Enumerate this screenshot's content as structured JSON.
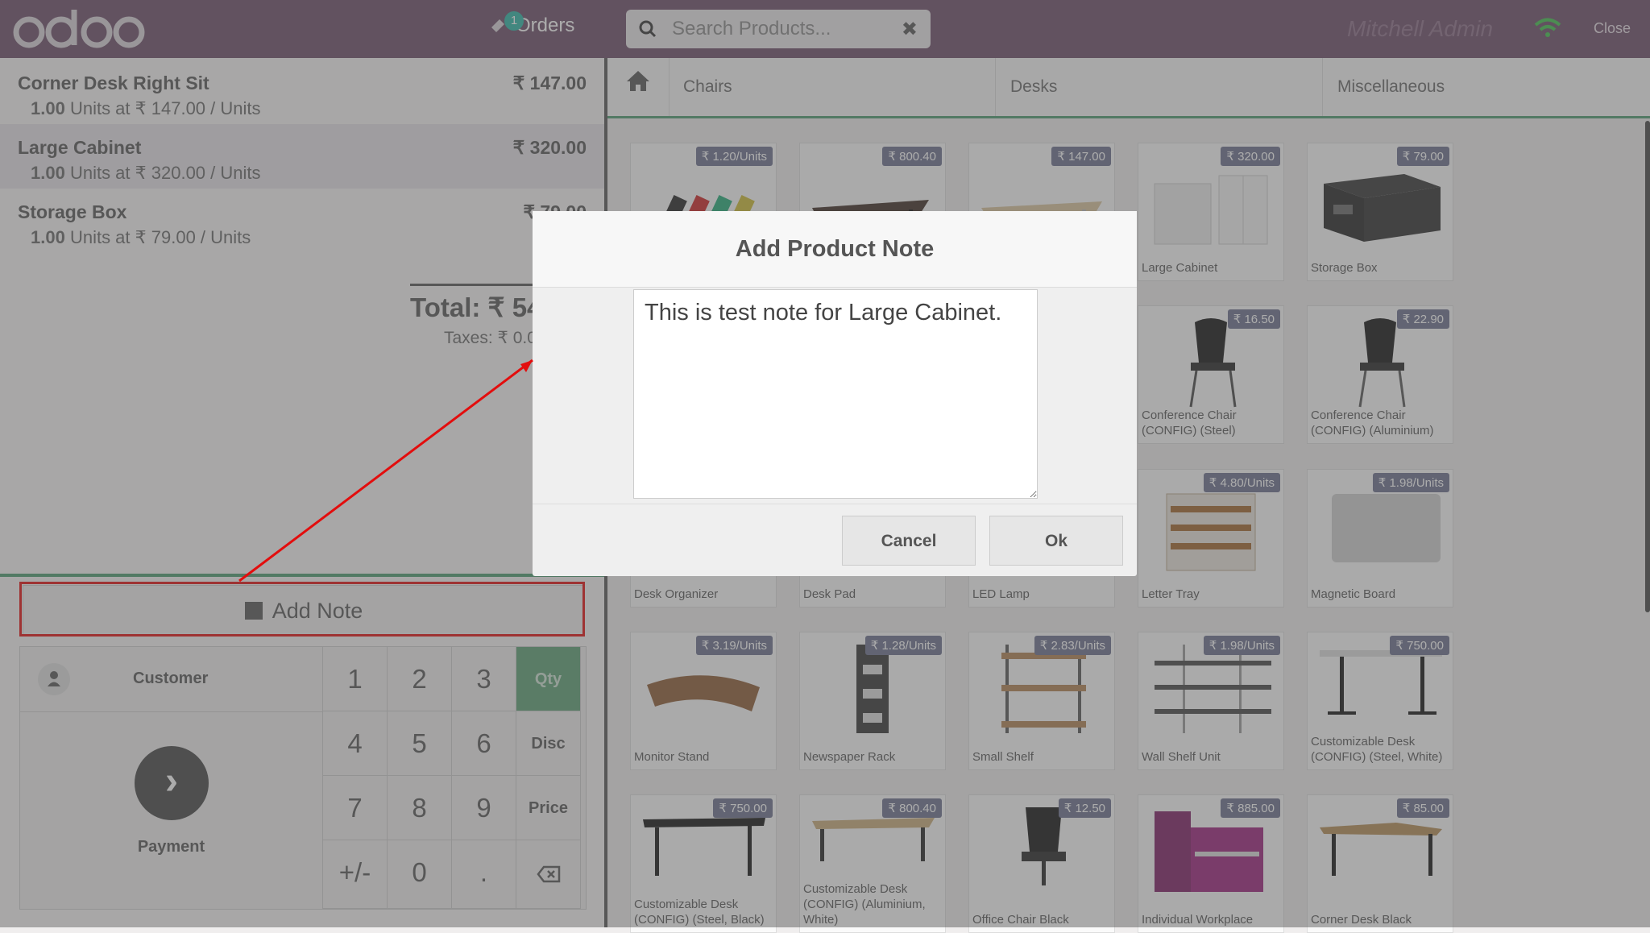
{
  "header": {
    "orders_label": "Orders",
    "orders_count": "1",
    "search_placeholder": "Search Products...",
    "user": "Mitchell Admin",
    "close_label": "Close"
  },
  "order": {
    "lines": [
      {
        "name": "Corner Desk Right Sit",
        "price": "₹ 147.00",
        "info_qty": "1.00",
        "info_rest": " Units at ₹ 147.00 / Units"
      },
      {
        "name": "Large Cabinet",
        "price": "₹ 320.00",
        "info_qty": "1.00",
        "info_rest": " Units at ₹ 320.00 / Units"
      },
      {
        "name": "Storage Box",
        "price": "₹ 79.00",
        "info_qty": "1.00",
        "info_rest": " Units at ₹ 79.00 / Units"
      }
    ],
    "total": "Total: ₹ 54",
    "taxes": "Taxes: ₹ 0.0"
  },
  "actions": {
    "add_note": "Add Note",
    "customer": "Customer",
    "payment": "Payment"
  },
  "numpad": {
    "keys": [
      "1",
      "2",
      "3",
      "Qty",
      "4",
      "5",
      "6",
      "Disc",
      "7",
      "8",
      "9",
      "Price",
      "+/-",
      "0",
      "."
    ],
    "active_mode": "Qty"
  },
  "categories": [
    "Chairs",
    "Desks",
    "Miscellaneous"
  ],
  "products": [
    {
      "name": "",
      "price": "₹ 1.20/Units"
    },
    {
      "name": "",
      "price": "₹ 800.40"
    },
    {
      "name": "",
      "price": "₹ 147.00"
    },
    {
      "name": "Large Cabinet",
      "price": "₹ 320.00"
    },
    {
      "name": "Storage Box",
      "price": "₹ 79.00"
    },
    {
      "name": "Conference Chair (CONFIG) (Steel)",
      "price": "₹ 16.50"
    },
    {
      "name": "Conference Chair (CONFIG) (Aluminium)",
      "price": "₹ 22.90"
    },
    {
      "name": "Desk Organizer",
      "price": ""
    },
    {
      "name": "Desk Pad",
      "price": ""
    },
    {
      "name": "LED Lamp",
      "price": ""
    },
    {
      "name": "Letter Tray",
      "price": "₹ 4.80/Units"
    },
    {
      "name": "Magnetic Board",
      "price": "₹ 1.98/Units"
    },
    {
      "name": "Monitor Stand",
      "price": "₹ 3.19/Units"
    },
    {
      "name": "Newspaper Rack",
      "price": "₹ 1.28/Units"
    },
    {
      "name": "Small Shelf",
      "price": "₹ 2.83/Units"
    },
    {
      "name": "Wall Shelf Unit",
      "price": "₹ 1.98/Units"
    },
    {
      "name": "Customizable Desk (CONFIG) (Steel, White)",
      "price": "₹ 750.00"
    },
    {
      "name": "Customizable Desk (CONFIG) (Steel, Black)",
      "price": "₹ 750.00"
    },
    {
      "name": "Customizable Desk (CONFIG) (Aluminium, White)",
      "price": "₹ 800.40"
    },
    {
      "name": "Office Chair Black",
      "price": "₹ 12.50"
    },
    {
      "name": "Individual Workplace",
      "price": "₹ 885.00"
    },
    {
      "name": "Corner Desk Black",
      "price": "₹ 85.00"
    }
  ],
  "modal": {
    "title": "Add Product Note",
    "note_value": "This is test note for Large Cabinet.",
    "cancel": "Cancel",
    "ok": "Ok"
  },
  "annotation": {
    "color": "#e30d0d"
  }
}
